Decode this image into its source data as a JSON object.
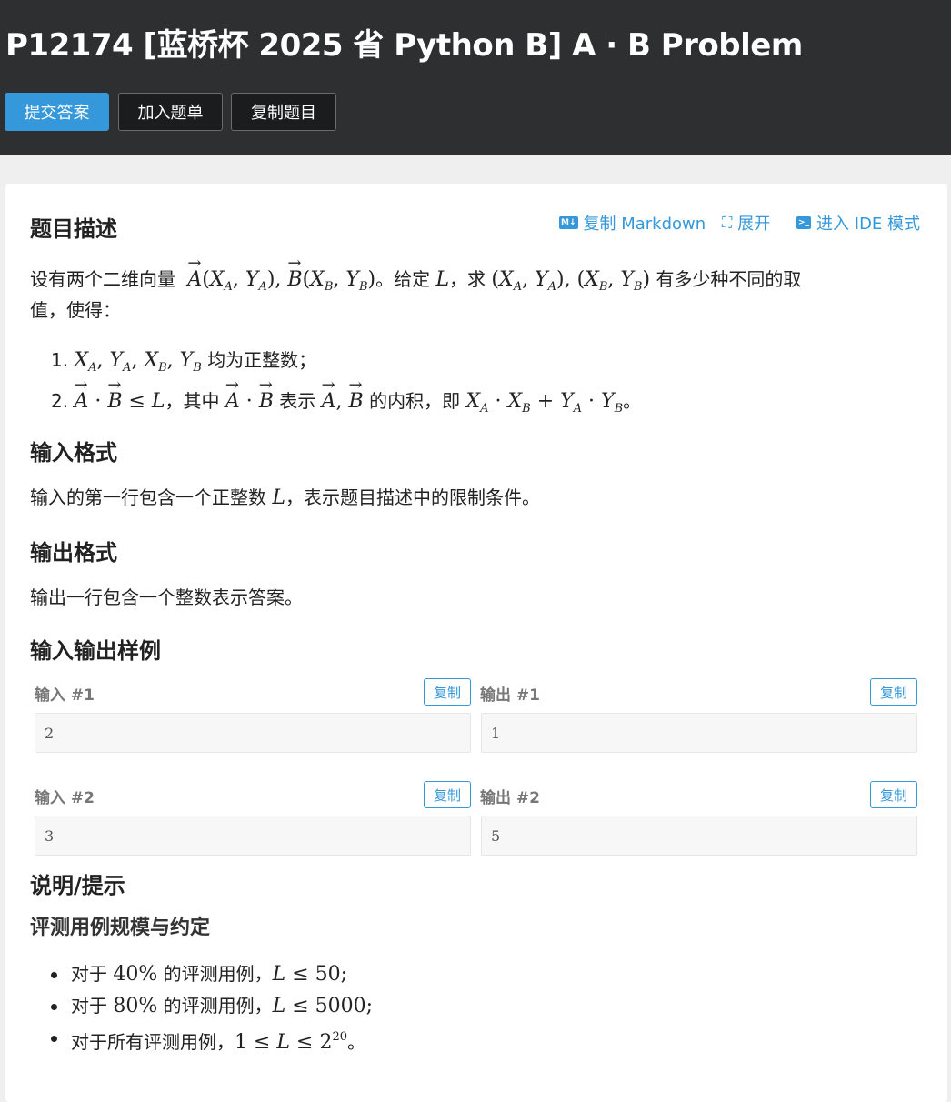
{
  "header": {
    "title": "P12174 [蓝桥杯 2025 省 Python B] A · B Problem",
    "buttons": {
      "submit": "提交答案",
      "add_list": "加入题单",
      "copy_problem": "复制题目"
    }
  },
  "toolbar": {
    "copy_markdown": "复制 Markdown",
    "expand": "展开",
    "ide": "进入 IDE 模式"
  },
  "description": {
    "title": "题目描述",
    "intro_1": "设有两个二维向量",
    "intro_2": "。给定",
    "intro_3": "，求",
    "intro_4": "有多少种不同的取",
    "intro_5": "值，使得：",
    "item1_text": "均为正整数；",
    "item2_a": "，其中",
    "item2_b": "表示",
    "item2_c": "的内积，即",
    "item2_end": "。"
  },
  "input_format": {
    "title": "输入格式",
    "text_a": "输入的第一行包含一个正整数",
    "text_b": "，表示题目描述中的限制条件。"
  },
  "output_format": {
    "title": "输出格式",
    "text": "输出一行包含一个整数表示答案。"
  },
  "samples": {
    "title": "输入输出样例",
    "copy_label": "复制",
    "items": [
      {
        "in_label": "输入 #1",
        "out_label": "输出 #1",
        "input": "2",
        "output": "1"
      },
      {
        "in_label": "输入 #2",
        "out_label": "输出 #2",
        "input": "3",
        "output": "5"
      }
    ]
  },
  "hint": {
    "title": "说明/提示",
    "subtitle": "评测用例规模与约定",
    "b1_a": "对于",
    "b1_pct": "40%",
    "b1_b": "的评测用例，",
    "b2_a": "对于",
    "b2_pct": "80%",
    "b2_b": "的评测用例，",
    "b3_a": "对于所有评测用例，"
  }
}
